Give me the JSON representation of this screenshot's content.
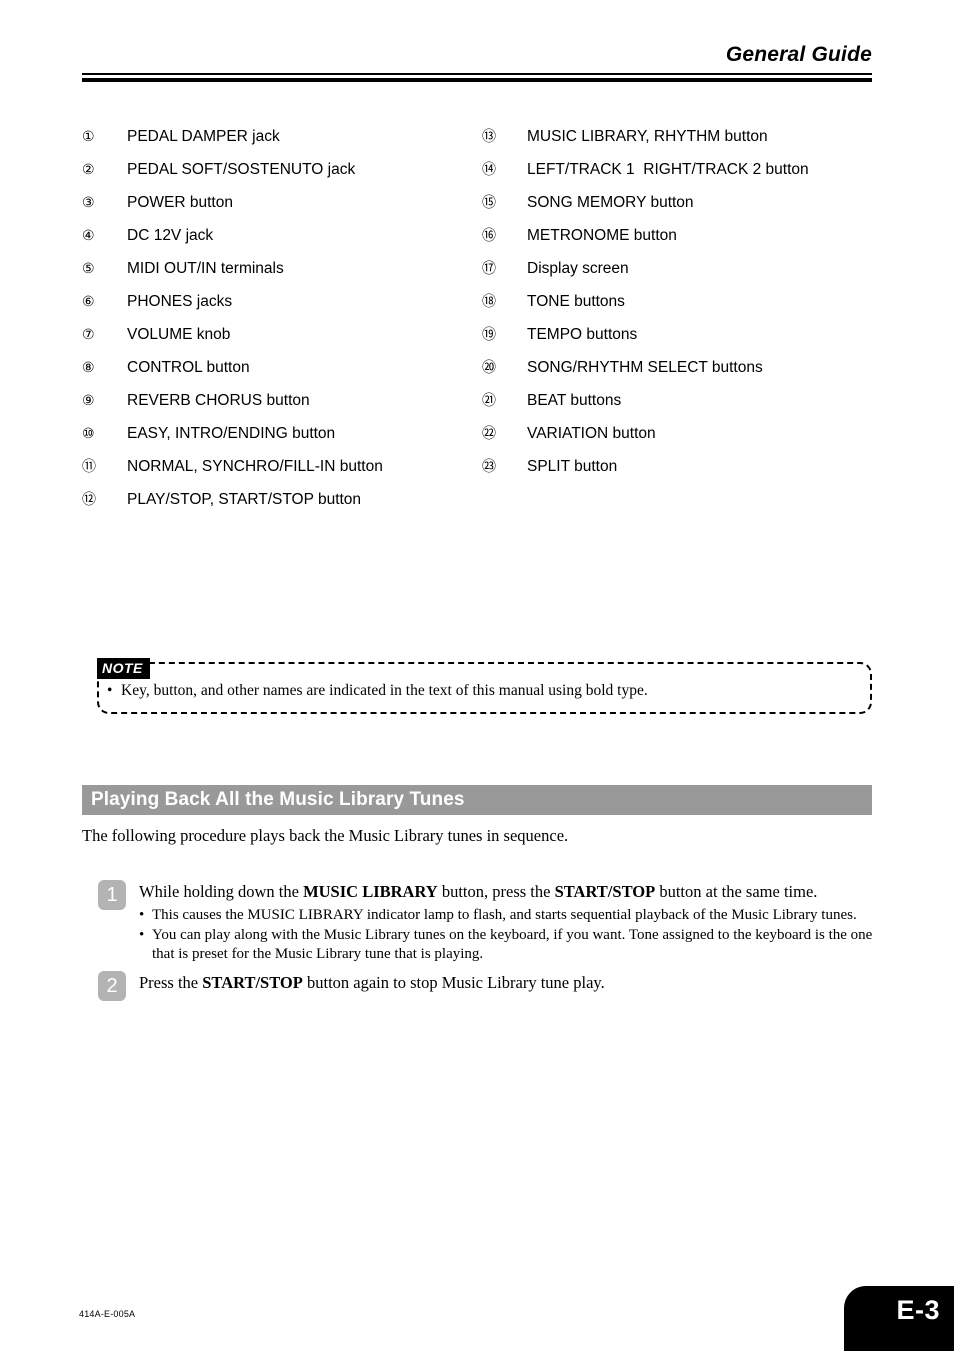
{
  "header": {
    "title": "General Guide"
  },
  "parts_list": {
    "left_column": [
      {
        "num": "①",
        "label": "PEDAL DAMPER jack"
      },
      {
        "num": "②",
        "label": "PEDAL SOFT/SOSTENUTO jack"
      },
      {
        "num": "③",
        "label": "POWER button"
      },
      {
        "num": "④",
        "label": "DC 12V jack"
      },
      {
        "num": "⑤",
        "label": "MIDI OUT/IN terminals"
      },
      {
        "num": "⑥",
        "label": "PHONES jacks"
      },
      {
        "num": "⑦",
        "label": "VOLUME knob"
      },
      {
        "num": "⑧",
        "label": "CONTROL button"
      },
      {
        "num": "⑨",
        "label": "REVERB CHORUS button"
      },
      {
        "num": "⑩",
        "label": "EASY, INTRO/ENDING button"
      },
      {
        "num": "⑪",
        "label": "NORMAL, SYNCHRO/FILL-IN button"
      },
      {
        "num": "⑫",
        "label": "PLAY/STOP, START/STOP button"
      }
    ],
    "right_column": [
      {
        "num": "⑬",
        "label": "MUSIC LIBRARY, RHYTHM button"
      },
      {
        "num": "⑭",
        "label": "LEFT/TRACK 1  RIGHT/TRACK 2 button"
      },
      {
        "num": "⑮",
        "label": "SONG MEMORY button"
      },
      {
        "num": "⑯",
        "label": "METRONOME button"
      },
      {
        "num": "⑰",
        "label": "Display screen"
      },
      {
        "num": "⑱",
        "label": "TONE buttons"
      },
      {
        "num": "⑲",
        "label": "TEMPO buttons"
      },
      {
        "num": "⑳",
        "label": "SONG/RHYTHM SELECT buttons"
      },
      {
        "num": "㉑",
        "label": "BEAT buttons"
      },
      {
        "num": "㉒",
        "label": "VARIATION button"
      },
      {
        "num": "㉓",
        "label": "SPLIT button"
      }
    ]
  },
  "note": {
    "tab_label": "NOTE",
    "bullet": "•",
    "text": "Key, button, and other names are indicated in the text of this manual using bold type."
  },
  "section": {
    "heading": "Playing Back All the Music Library Tunes",
    "intro": "The following procedure plays back the Music Library tunes in sequence."
  },
  "steps": [
    {
      "number": "1",
      "title_parts": [
        {
          "text": "While holding down the ",
          "bold": false
        },
        {
          "text": "MUSIC LIBRARY",
          "bold": true
        },
        {
          "text": " button, press the ",
          "bold": false
        },
        {
          "text": "START/STOP",
          "bold": true
        },
        {
          "text": " button at the same time.",
          "bold": false
        }
      ],
      "subitems": [
        "This causes the MUSIC LIBRARY indicator lamp to flash, and starts sequential playback of the Music Library tunes.",
        "You can play along with the Music Library tunes on the keyboard, if you want. Tone assigned to the keyboard is the one that is preset for the Music Library tune that is playing."
      ]
    },
    {
      "number": "2",
      "title_parts": [
        {
          "text": "Press the ",
          "bold": false
        },
        {
          "text": "START/STOP",
          "bold": true
        },
        {
          "text": " button again to stop Music Library tune play.",
          "bold": false
        }
      ],
      "subitems": []
    }
  ],
  "bullets": {
    "sub_bullet": "•"
  },
  "footer": {
    "code": "414A-E-005A",
    "page_label": "E-3"
  },
  "colors": {
    "section_bar_bg": "#999999",
    "step_badge_bg": "#b3b3b3",
    "page_tab_bg": "#000000"
  }
}
